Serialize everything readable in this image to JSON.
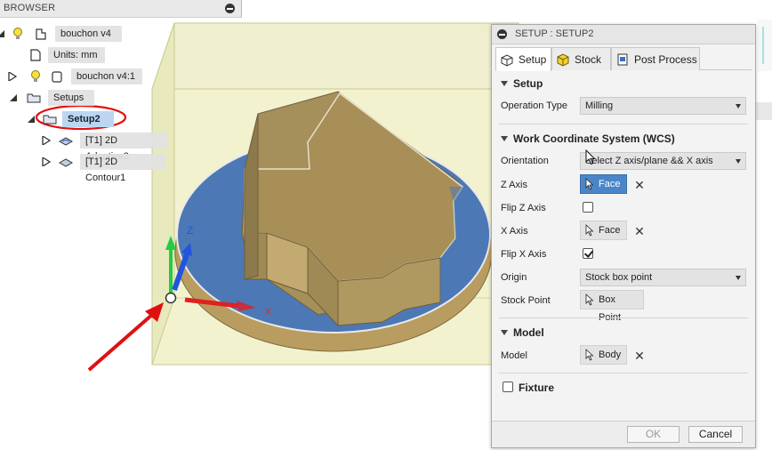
{
  "browser": {
    "title": "BROWSER",
    "items": [
      {
        "label": "bouchon v4"
      },
      {
        "label": "Units: mm"
      },
      {
        "label": "bouchon v4:1"
      },
      {
        "label": "Setups"
      },
      {
        "label": "Setup2"
      },
      {
        "label": "[T1] 2D Adaptive2"
      },
      {
        "label": "[T1] 2D Contour1"
      }
    ]
  },
  "viewport": {
    "axis_z": "Z",
    "axis_x": "X"
  },
  "panel": {
    "title": "SETUP : SETUP2",
    "tabs": [
      {
        "label": "Setup",
        "active": true
      },
      {
        "label": "Stock",
        "active": false
      },
      {
        "label": "Post Process",
        "active": false
      }
    ],
    "setup_section": {
      "title": "Setup",
      "operation_type_label": "Operation Type",
      "operation_type_value": "Milling"
    },
    "wcs_section": {
      "title": "Work Coordinate System (WCS)",
      "orientation_label": "Orientation",
      "orientation_value": "Select Z axis/plane && X axis",
      "z_axis_label": "Z Axis",
      "z_axis_value": "Face",
      "flip_z_label": "Flip Z Axis",
      "flip_z_checked": false,
      "x_axis_label": "X Axis",
      "x_axis_value": "Face",
      "flip_x_label": "Flip X Axis",
      "flip_x_checked": true,
      "origin_label": "Origin",
      "origin_value": "Stock box point",
      "stock_point_label": "Stock Point",
      "stock_point_value": "Box Point"
    },
    "model_section": {
      "title": "Model",
      "model_label": "Model",
      "model_value": "Body"
    },
    "fixture_section": {
      "title": "Fixture"
    },
    "footer": {
      "ok_label": "OK",
      "cancel_label": "Cancel"
    }
  },
  "colors": {
    "stock_fill": "#efefc8",
    "part_top": "#4a74b3",
    "part_side": "#b4995c",
    "boss_top": "#a88f5a",
    "selection_blue": "#4a86c7",
    "annotation_red": "#e01010",
    "axis_z_green": "#22cc44",
    "axis_blue": "#2255dd",
    "axis_x_red": "#e02020"
  }
}
